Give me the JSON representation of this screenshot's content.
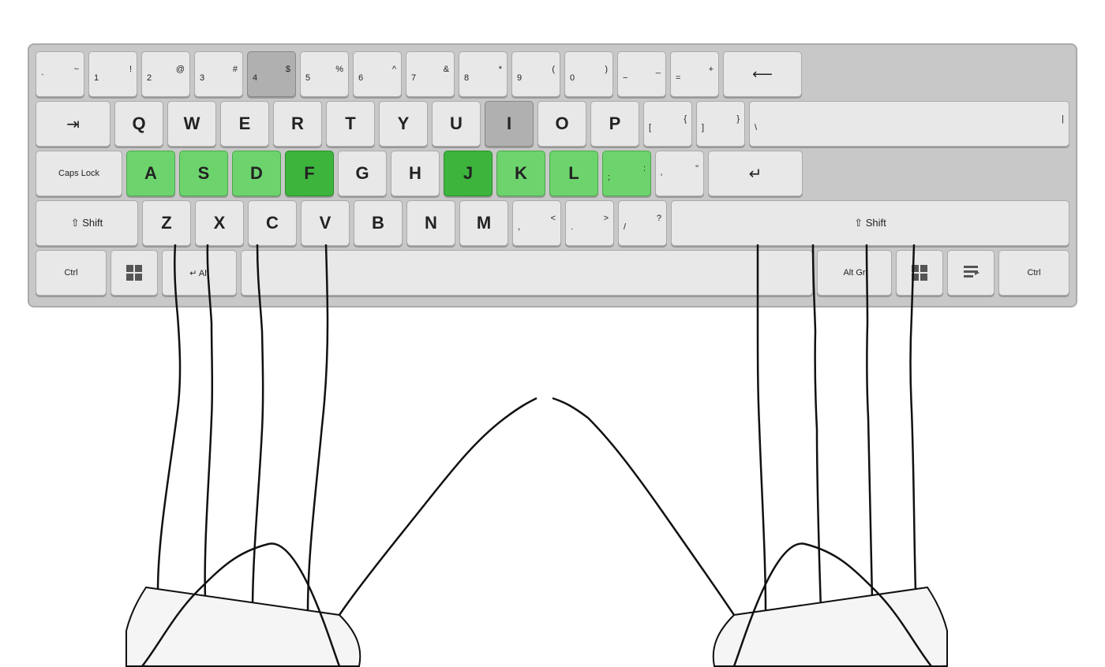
{
  "keyboard": {
    "rows": [
      {
        "id": "row-numbers",
        "keys": [
          {
            "id": "grave",
            "top": "~",
            "bottom": "`",
            "type": "symbol",
            "width": "w1"
          },
          {
            "id": "1",
            "top": "!",
            "bottom": "1",
            "type": "symbol",
            "width": "w1"
          },
          {
            "id": "2",
            "top": "@",
            "bottom": "2",
            "type": "symbol",
            "width": "w1"
          },
          {
            "id": "3",
            "top": "#",
            "bottom": "3",
            "type": "symbol",
            "width": "w1"
          },
          {
            "id": "4",
            "top": "$",
            "bottom": "4",
            "type": "symbol",
            "width": "w1",
            "color": "gray-dark"
          },
          {
            "id": "5",
            "top": "%",
            "bottom": "5",
            "type": "symbol",
            "width": "w1"
          },
          {
            "id": "6",
            "top": "^",
            "bottom": "6",
            "type": "symbol",
            "width": "w1"
          },
          {
            "id": "7",
            "top": "&",
            "bottom": "7",
            "type": "symbol",
            "width": "w1"
          },
          {
            "id": "8",
            "top": "*",
            "bottom": "8",
            "type": "symbol",
            "width": "w1"
          },
          {
            "id": "9",
            "top": "(",
            "bottom": "9",
            "type": "symbol",
            "width": "w1"
          },
          {
            "id": "0",
            "top": ")",
            "bottom": "0",
            "type": "symbol",
            "width": "w1"
          },
          {
            "id": "minus",
            "top": "_",
            "bottom": "−",
            "type": "symbol",
            "width": "w1"
          },
          {
            "id": "equals",
            "top": "+",
            "bottom": "=",
            "type": "symbol",
            "width": "w1"
          },
          {
            "id": "backspace",
            "label": "⌫",
            "type": "special",
            "width": "w-backspace"
          }
        ]
      },
      {
        "id": "row-qwerty",
        "keys": [
          {
            "id": "tab",
            "label": "⇥",
            "type": "special",
            "width": "w-tab"
          },
          {
            "id": "q",
            "label": "Q",
            "type": "letter",
            "width": "w1"
          },
          {
            "id": "w",
            "label": "W",
            "type": "letter",
            "width": "w1"
          },
          {
            "id": "e",
            "label": "E",
            "type": "letter",
            "width": "w1"
          },
          {
            "id": "r",
            "label": "R",
            "type": "letter",
            "width": "w1"
          },
          {
            "id": "t",
            "label": "T",
            "type": "letter",
            "width": "w1"
          },
          {
            "id": "y",
            "label": "Y",
            "type": "letter",
            "width": "w1"
          },
          {
            "id": "u",
            "label": "U",
            "type": "letter",
            "width": "w1"
          },
          {
            "id": "i",
            "label": "I",
            "type": "letter",
            "width": "w1",
            "color": "gray-dark"
          },
          {
            "id": "o",
            "label": "O",
            "type": "letter",
            "width": "w1"
          },
          {
            "id": "p",
            "label": "P",
            "type": "letter",
            "width": "w1"
          },
          {
            "id": "lbracket",
            "top": "{",
            "bottom": "[",
            "type": "symbol",
            "width": "w1"
          },
          {
            "id": "rbracket",
            "top": "}",
            "bottom": "]",
            "type": "symbol",
            "width": "w1"
          },
          {
            "id": "backslash",
            "top": "|",
            "bottom": "\\",
            "type": "symbol",
            "width": "w1"
          }
        ]
      },
      {
        "id": "row-asdf",
        "keys": [
          {
            "id": "caps",
            "label": "Caps Lock",
            "type": "special",
            "width": "w-caps"
          },
          {
            "id": "a",
            "label": "A",
            "type": "letter",
            "width": "w1",
            "color": "green"
          },
          {
            "id": "s",
            "label": "S",
            "type": "letter",
            "width": "w1",
            "color": "green"
          },
          {
            "id": "d",
            "label": "D",
            "type": "letter",
            "width": "w1",
            "color": "green"
          },
          {
            "id": "f",
            "label": "F",
            "type": "letter",
            "width": "w1",
            "color": "dark-green"
          },
          {
            "id": "g",
            "label": "G",
            "type": "letter",
            "width": "w1"
          },
          {
            "id": "h",
            "label": "H",
            "type": "letter",
            "width": "w1"
          },
          {
            "id": "j",
            "label": "J",
            "type": "letter",
            "width": "w1",
            "color": "dark-green"
          },
          {
            "id": "k",
            "label": "K",
            "type": "letter",
            "width": "w1",
            "color": "green"
          },
          {
            "id": "l",
            "label": "L",
            "type": "letter",
            "width": "w1",
            "color": "green"
          },
          {
            "id": "semicolon",
            "top": ":",
            "bottom": ";",
            "type": "symbol",
            "width": "w1",
            "color": "green"
          },
          {
            "id": "quote",
            "top": "\"",
            "bottom": "'",
            "type": "symbol",
            "width": "w1"
          },
          {
            "id": "enter",
            "label": "↵",
            "type": "special",
            "width": "w-enter"
          }
        ]
      },
      {
        "id": "row-zxcv",
        "keys": [
          {
            "id": "shift-l",
            "label": "⇧ Shift",
            "type": "special",
            "width": "w-shift-l"
          },
          {
            "id": "z",
            "label": "Z",
            "type": "letter",
            "width": "w1"
          },
          {
            "id": "x",
            "label": "X",
            "type": "letter",
            "width": "w1"
          },
          {
            "id": "c",
            "label": "C",
            "type": "letter",
            "width": "w1"
          },
          {
            "id": "v",
            "label": "V",
            "type": "letter",
            "width": "w1"
          },
          {
            "id": "b",
            "label": "B",
            "type": "letter",
            "width": "w1"
          },
          {
            "id": "n",
            "label": "N",
            "type": "letter",
            "width": "w1"
          },
          {
            "id": "m",
            "label": "M",
            "type": "letter",
            "width": "w1"
          },
          {
            "id": "comma",
            "top": "<",
            "bottom": ",",
            "type": "symbol",
            "width": "w1"
          },
          {
            "id": "period",
            "top": ">",
            "bottom": ".",
            "type": "symbol",
            "width": "w1"
          },
          {
            "id": "slash",
            "top": "?",
            "bottom": "/",
            "type": "symbol",
            "width": "w1"
          },
          {
            "id": "shift-r",
            "label": "⇧ Shift",
            "type": "special",
            "width": "w-shift-r"
          }
        ]
      },
      {
        "id": "row-bottom",
        "keys": [
          {
            "id": "ctrl-l",
            "label": "Ctrl",
            "type": "special",
            "width": "w-ctrl"
          },
          {
            "id": "win-l",
            "label": "⊞",
            "type": "special",
            "width": "w-win"
          },
          {
            "id": "alt",
            "label": "Alt",
            "type": "special",
            "width": "w-alt"
          },
          {
            "id": "space",
            "label": "",
            "type": "special",
            "width": "w-space"
          },
          {
            "id": "altgr",
            "label": "Alt Gr",
            "type": "special",
            "width": "w-altgr"
          },
          {
            "id": "win-r",
            "label": "⊞",
            "type": "special",
            "width": "w-win"
          },
          {
            "id": "menu",
            "label": "☰",
            "type": "special",
            "width": "w-menu"
          },
          {
            "id": "ctrl-r",
            "label": "Ctrl",
            "type": "special",
            "width": "w-ctrl"
          }
        ]
      }
    ]
  }
}
